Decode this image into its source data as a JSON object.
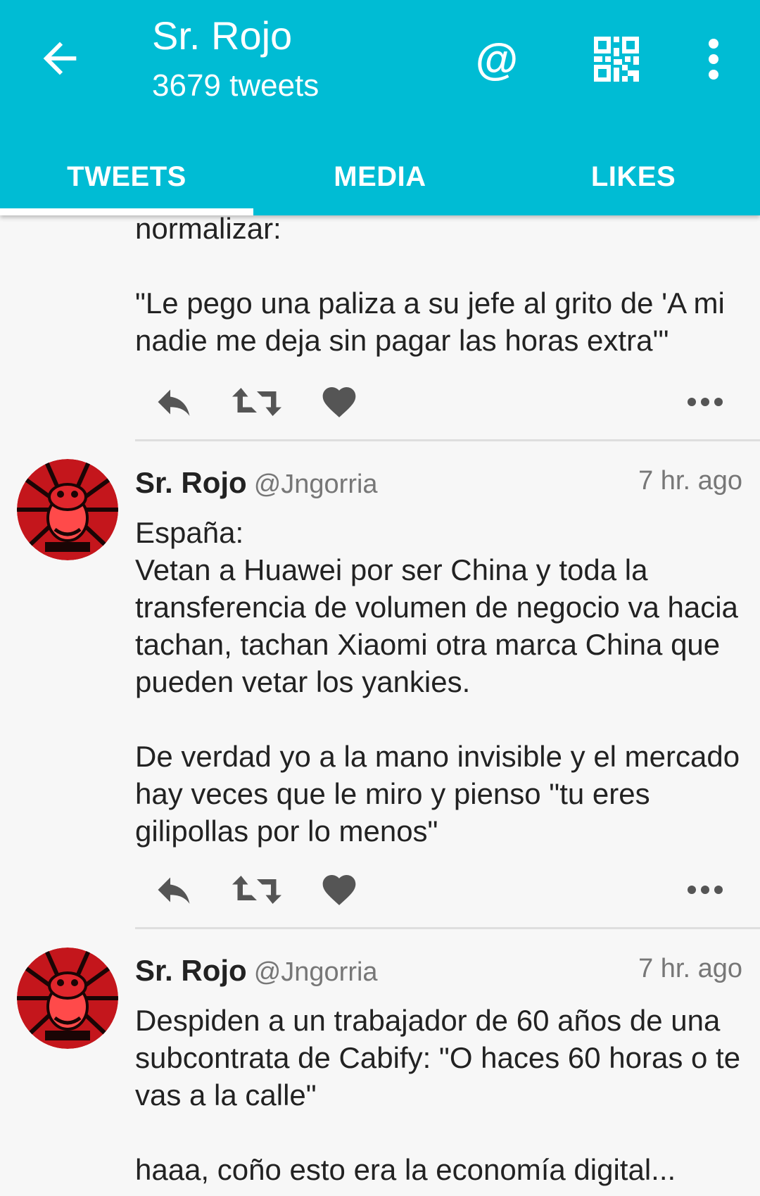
{
  "header": {
    "title": "Sr. Rojo",
    "subtitle": "3679 tweets",
    "mention_label": "@",
    "accent_color": "#00bcd4"
  },
  "tabs": [
    {
      "label": "TWEETS",
      "active": true
    },
    {
      "label": "MEDIA",
      "active": false
    },
    {
      "label": "LIKES",
      "active": false
    }
  ],
  "tweets": [
    {
      "text": "normalizar:\n\n\"Le pego una paliza a su jefe al grito de 'A mi nadie me deja sin pagar las horas extra'\""
    },
    {
      "name": "Sr. Rojo",
      "handle": "@Jngorria",
      "time": "7 hr. ago",
      "text": "España:\nVetan a Huawei por ser China y toda la transferencia de volumen de negocio va hacia tachan, tachan Xiaomi otra marca China que pueden vetar los yankies.\n\nDe verdad yo a la mano invisible y el mercado hay veces que le miro y pienso \"tu eres gilipollas por lo menos\""
    },
    {
      "name": "Sr. Rojo",
      "handle": "@Jngorria",
      "time": "7 hr. ago",
      "text": "Despiden a un trabajador de 60 años de una subcontrata de Cabify: \"O haces 60 horas o te vas a la calle\"\n\nhaaa, coño esto era la economía digital..."
    }
  ],
  "icons": {
    "back": "arrow-left-icon",
    "mention": "at-sign-icon",
    "qr": "qr-code-icon",
    "overflow": "more-vertical-icon",
    "reply": "reply-icon",
    "retweet": "retweet-icon",
    "like": "heart-icon",
    "tweet_more": "more-horizontal-icon"
  }
}
